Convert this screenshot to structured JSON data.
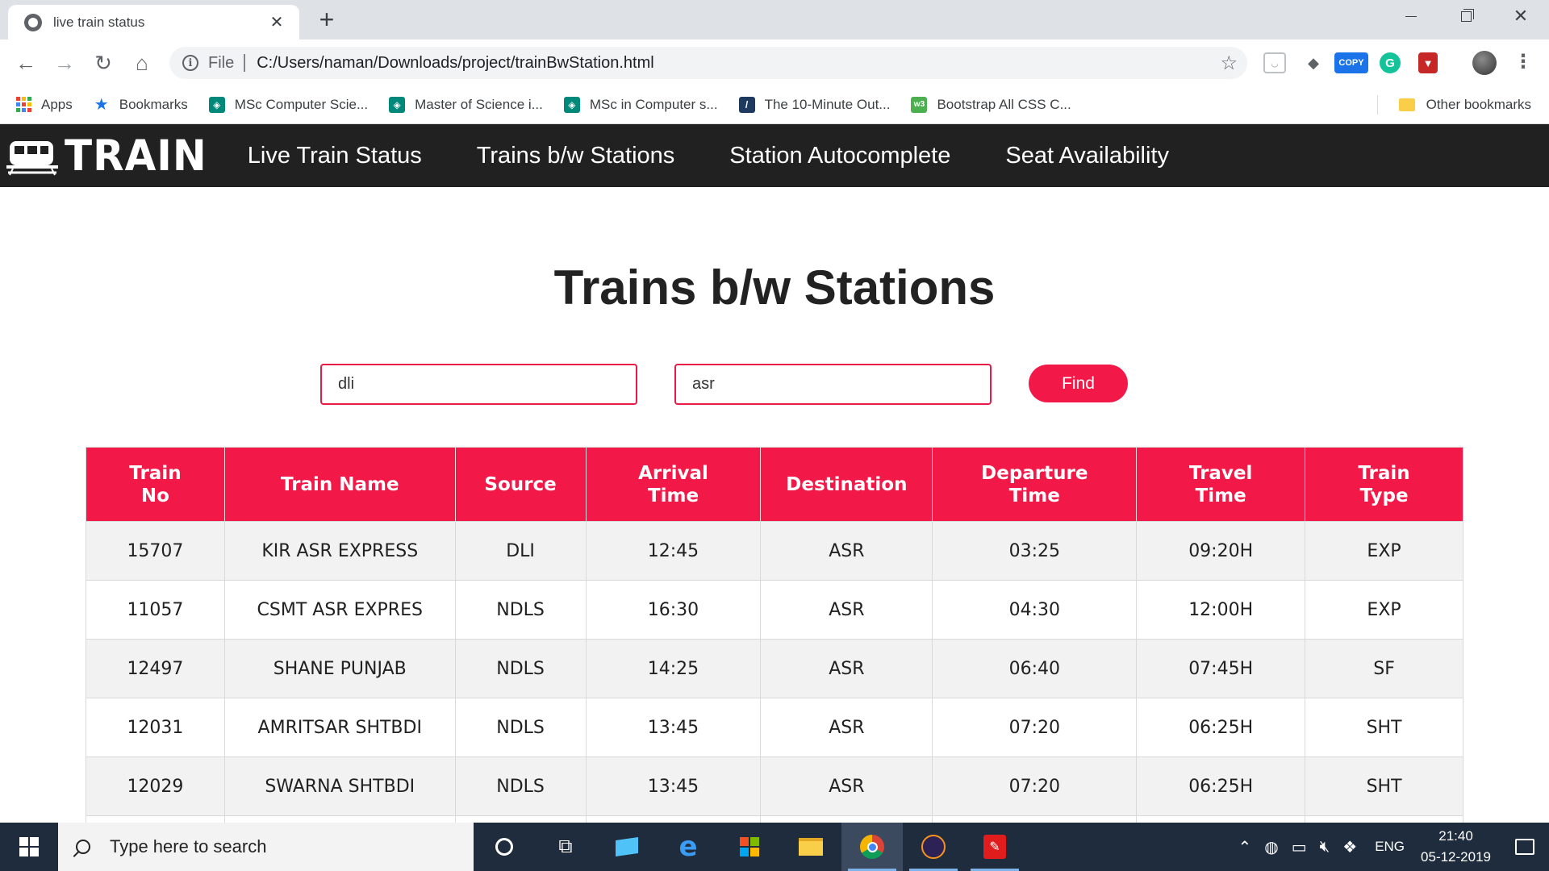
{
  "browser": {
    "tab_title": "live train status",
    "scheme_label": "File",
    "url": "C:/Users/naman/Downloads/project/trainBwStation.html",
    "extension_copy_label": "COPY",
    "bookmarks": [
      {
        "label": "Apps",
        "icon": "apps-grid-icon"
      },
      {
        "label": "Bookmarks",
        "icon": "star-icon"
      },
      {
        "label": "MSc Computer Scie...",
        "icon": "university-icon"
      },
      {
        "label": "Master of Science i...",
        "icon": "university-icon"
      },
      {
        "label": "MSc in Computer s...",
        "icon": "university-icon"
      },
      {
        "label": "The 10-Minute Out...",
        "icon": "slash-icon"
      },
      {
        "label": "Bootstrap All CSS C...",
        "icon": "w3-icon"
      }
    ],
    "other_bookmarks": "Other bookmarks"
  },
  "site": {
    "logo_text": "TRAIN",
    "nav": [
      "Live Train Status",
      "Trains b/w Stations",
      "Station Autocomplete",
      "Seat Availability"
    ]
  },
  "main": {
    "title": "Trains b/w Stations",
    "from_value": "dli",
    "to_value": "asr",
    "find_label": "Find"
  },
  "table": {
    "headers": [
      [
        "Train",
        "No"
      ],
      [
        "Train Name",
        ""
      ],
      [
        "Source",
        ""
      ],
      [
        "Arrival",
        "Time"
      ],
      [
        "Destination",
        ""
      ],
      [
        "Departure",
        "Time"
      ],
      [
        "Travel",
        "Time"
      ],
      [
        "Train",
        "Type"
      ]
    ],
    "rows": [
      [
        "15707",
        "KIR ASR EXPRESS",
        "DLI",
        "12:45",
        "ASR",
        "03:25",
        "09:20H",
        "EXP"
      ],
      [
        "11057",
        "CSMT ASR EXPRES",
        "NDLS",
        "16:30",
        "ASR",
        "04:30",
        "12:00H",
        "EXP"
      ],
      [
        "12497",
        "SHANE PUNJAB",
        "NDLS",
        "14:25",
        "ASR",
        "06:40",
        "07:45H",
        "SF"
      ],
      [
        "12031",
        "AMRITSAR SHTBDI",
        "NDLS",
        "13:45",
        "ASR",
        "07:20",
        "06:25H",
        "SHT"
      ],
      [
        "12029",
        "SWARNA SHTBDI",
        "NDLS",
        "13:45",
        "ASR",
        "07:20",
        "06:25H",
        "SHT"
      ],
      [
        "",
        "",
        "",
        "",
        "",
        "",
        "",
        ""
      ]
    ]
  },
  "taskbar": {
    "search_placeholder": "Type here to search",
    "language": "ENG",
    "time": "21:40",
    "date": "05-12-2019"
  },
  "colors": {
    "accent": "#f21848",
    "navbar": "#212121",
    "taskbar": "#1f2c3d"
  }
}
